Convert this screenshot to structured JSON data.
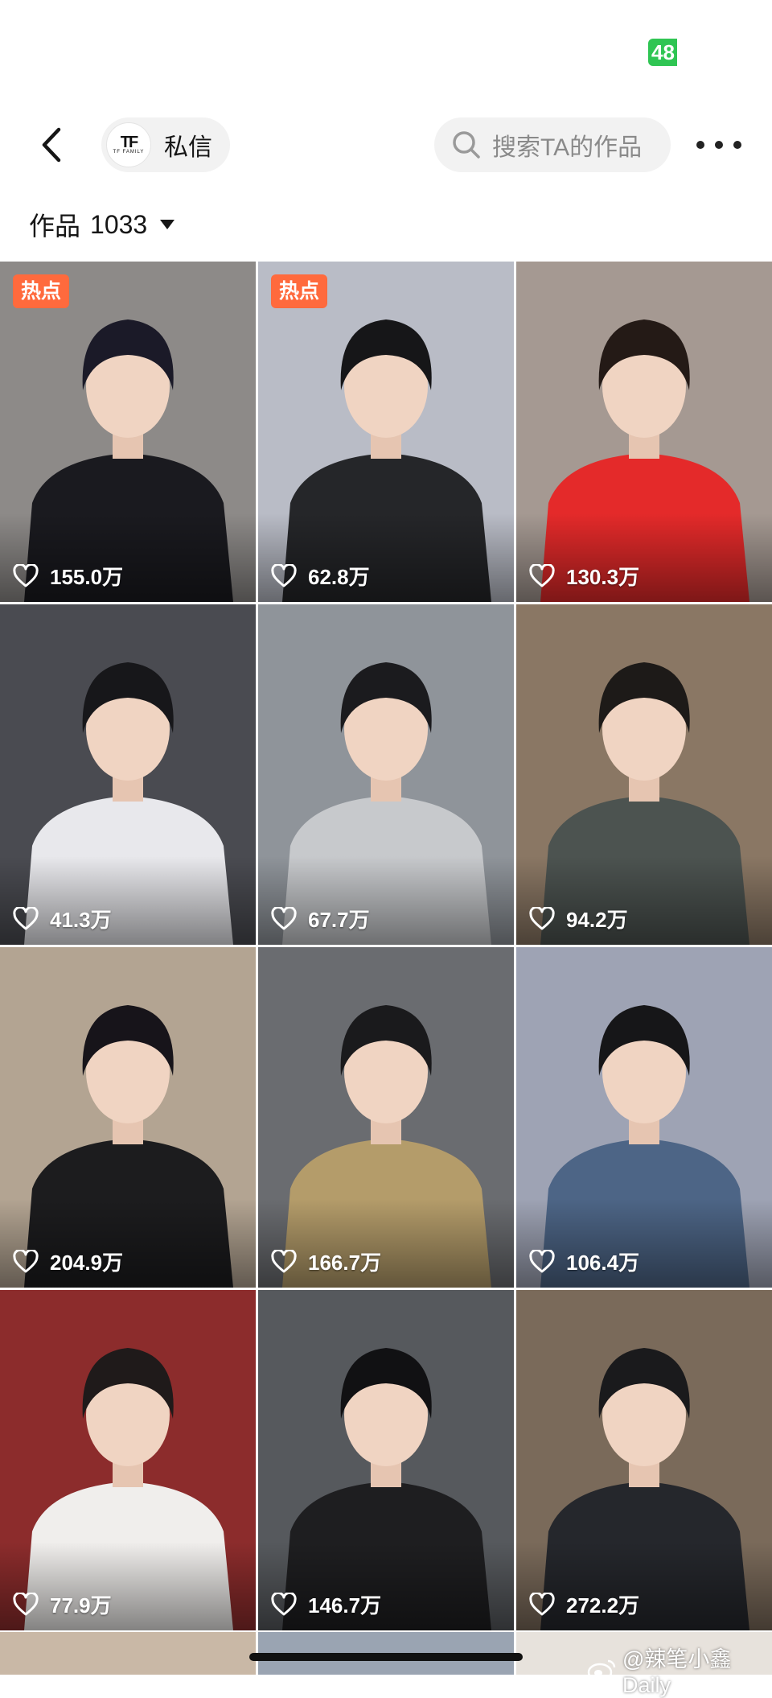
{
  "status_bar": {
    "battery_text": "48"
  },
  "nav": {
    "message_label": "私信",
    "avatar_logo": "TF",
    "avatar_logo_sub": "TF FAMILY",
    "search_placeholder": "搜索TA的作品"
  },
  "works": {
    "label": "作品",
    "count": "1033"
  },
  "tiles": [
    {
      "likes": "155.0万",
      "hot": "热点",
      "bg": "#8d8a88",
      "shirt": "#1a1a1f",
      "hair": "#1b1a28"
    },
    {
      "likes": "62.8万",
      "hot": "热点",
      "bg": "#b9bcc6",
      "shirt": "#252629",
      "hair": "#161618"
    },
    {
      "likes": "130.3万",
      "bg": "#a59992",
      "shirt": "#e42a2a",
      "hair": "#241a16"
    },
    {
      "likes": "41.3万",
      "bg": "#4a4b51",
      "shirt": "#e8e8ec",
      "hair": "#17171a"
    },
    {
      "likes": "67.7万",
      "bg": "#8f949a",
      "shirt": "#c7c9cc",
      "hair": "#1b1b1e"
    },
    {
      "likes": "94.2万",
      "bg": "#8a7764",
      "shirt": "#4c5350",
      "hair": "#1d1a18"
    },
    {
      "likes": "204.9万",
      "bg": "#b3a492",
      "shirt": "#1c1c1e",
      "hair": "#17141a"
    },
    {
      "likes": "166.7万",
      "bg": "#6a6c70",
      "shirt": "#b49c6a",
      "hair": "#1a1a1c"
    },
    {
      "likes": "106.4万",
      "bg": "#9ea3b4",
      "shirt": "#4d6586",
      "hair": "#161618"
    },
    {
      "likes": "77.9万",
      "bg": "#8c2c2c",
      "shirt": "#f0eeec",
      "hair": "#1f1a1a"
    },
    {
      "likes": "146.7万",
      "bg": "#56595d",
      "shirt": "#1e1e20",
      "hair": "#111113"
    },
    {
      "likes": "272.2万",
      "bg": "#7a6a5a",
      "shirt": "#25272c",
      "hair": "#1a1a1c"
    }
  ],
  "partial_tiles": [
    {
      "bg": "#c9b8a6"
    },
    {
      "bg": "#9aa4b2"
    },
    {
      "bg": "#e7e2dc"
    }
  ],
  "watermark": {
    "text": "@辣笔小鑫Daily"
  },
  "colors": {
    "accent_hot": "#ff6a3d",
    "battery_green": "#2fc553",
    "pill_bg": "#f2f2f2"
  }
}
